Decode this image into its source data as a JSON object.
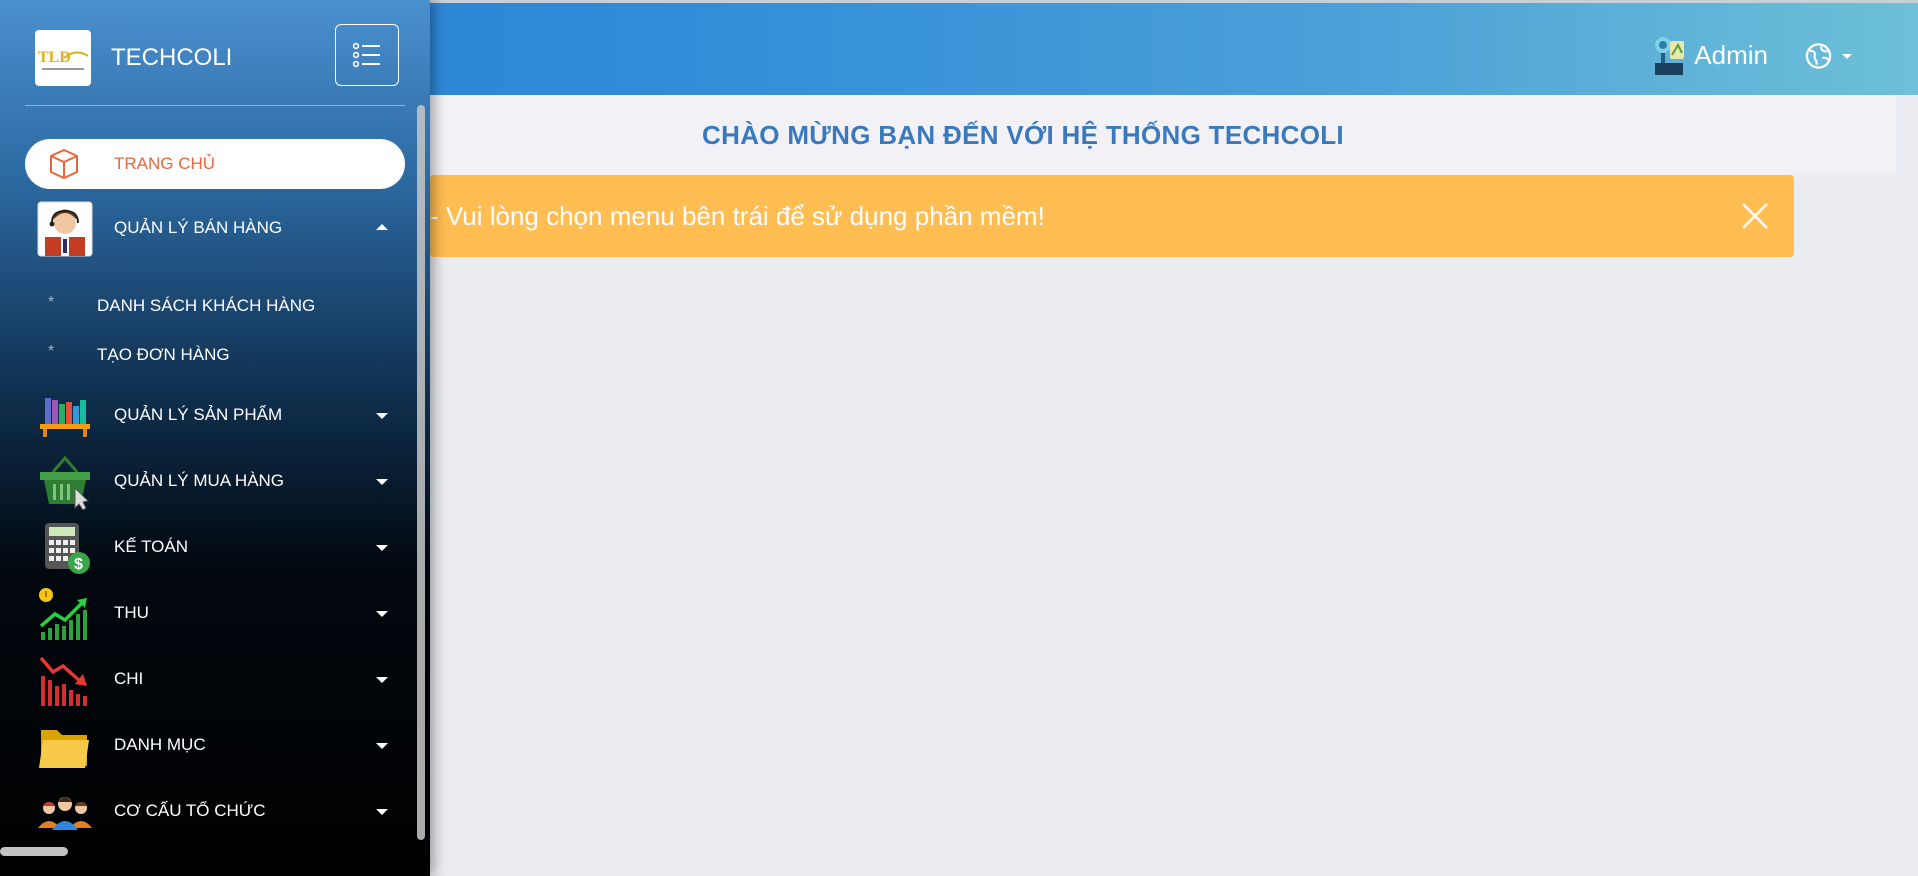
{
  "header": {
    "username": "Admin"
  },
  "main": {
    "welcome_title": "CHÀO MỪNG BẠN ĐẾN VỚI HỆ THỐNG TECHCOLI",
    "alert_text": "- Vui lòng chọn menu bên trái để sử dụng phần mềm!"
  },
  "sidebar": {
    "brand_name": "TECHCOLI",
    "logo_text": "TLD",
    "home_label": "TRANG CHỦ",
    "items": [
      {
        "label": "QUẢN LÝ BÁN HÀNG",
        "icon": "salesperson-icon",
        "expanded": true
      },
      {
        "label": "QUẢN LÝ SẢN PHẨM",
        "icon": "bookshelf-icon",
        "expanded": false
      },
      {
        "label": "QUẢN LÝ MUA HÀNG",
        "icon": "shopping-basket-icon",
        "expanded": false
      },
      {
        "label": "KẾ TOÁN",
        "icon": "calculator-icon",
        "expanded": false
      },
      {
        "label": "THU",
        "icon": "chart-up-icon",
        "expanded": false
      },
      {
        "label": "CHI",
        "icon": "chart-down-icon",
        "expanded": false
      },
      {
        "label": "DANH MỤC",
        "icon": "folder-icon",
        "expanded": false
      },
      {
        "label": "CƠ CẤU TỔ CHỨC",
        "icon": "team-icon",
        "expanded": false
      }
    ],
    "sub_items": [
      {
        "marker": "*",
        "label": "DANH SÁCH KHÁCH HÀNG"
      },
      {
        "marker": "*",
        "label": "TẠO ĐƠN HÀNG"
      }
    ]
  },
  "colors": {
    "accent_orange": "#e8663a",
    "title_blue": "#3b79bf",
    "alert_bg": "#ffbd52"
  }
}
